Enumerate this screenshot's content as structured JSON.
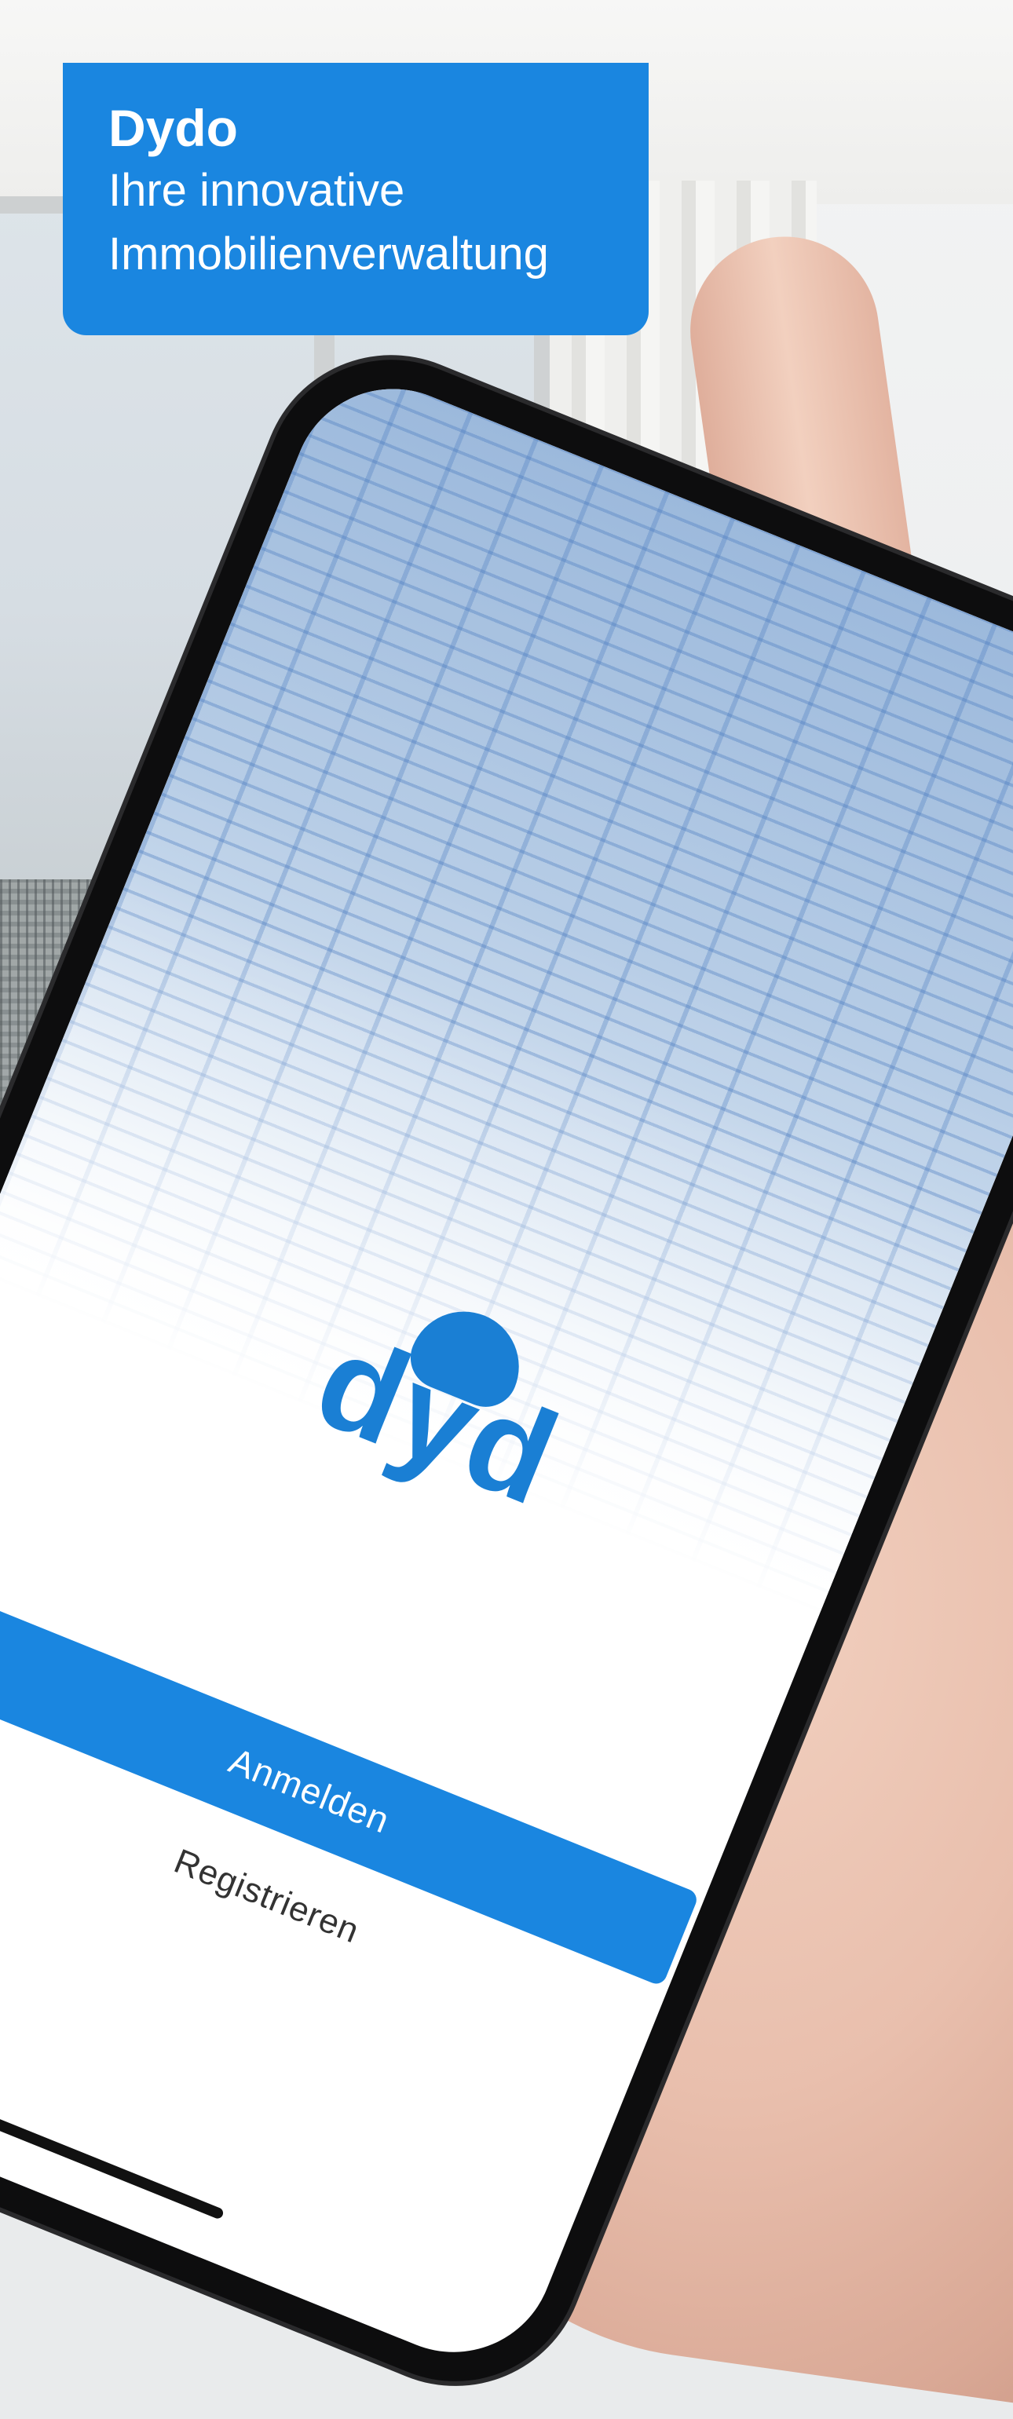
{
  "header": {
    "title": "Dydo",
    "subtitle_line1": "Ihre innovative",
    "subtitle_line2": "Immobilienverwaltung"
  },
  "app_screen": {
    "logo_text": "dyd",
    "login_label": "Anmelden",
    "register_label": "Registrieren"
  },
  "colors": {
    "brand_blue": "#1a86e0",
    "logo_blue": "#1a7fd4"
  }
}
